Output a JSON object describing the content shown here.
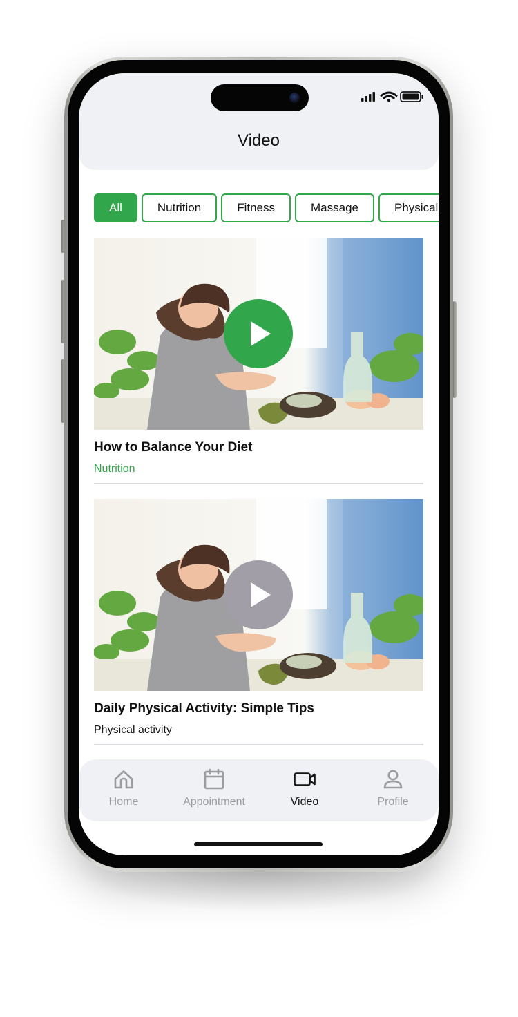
{
  "header": {
    "title": "Video"
  },
  "filters": [
    {
      "label": "All",
      "active": true
    },
    {
      "label": "Nutrition",
      "active": false
    },
    {
      "label": "Fitness",
      "active": false
    },
    {
      "label": "Massage",
      "active": false
    },
    {
      "label": "Physical",
      "active": false
    }
  ],
  "videos": [
    {
      "title": "How to Balance Your Diet",
      "category": "Nutrition",
      "category_color": "#31a64b",
      "play_color": "#31a64b"
    },
    {
      "title": "Daily Physical Activity: Simple Tips",
      "category": "Physical activity",
      "category_color": "#151515",
      "play_color": "#a29ea8"
    }
  ],
  "tabbar": {
    "items": [
      {
        "label": "Home",
        "icon": "home-icon",
        "active": false
      },
      {
        "label": "Appointment",
        "icon": "calendar-icon",
        "active": false
      },
      {
        "label": "Video",
        "icon": "video-camera-icon",
        "active": true
      },
      {
        "label": "Profile",
        "icon": "user-icon",
        "active": false
      }
    ]
  },
  "colors": {
    "accent": "#31a64b",
    "inactive_play": "#a29ea8",
    "header_bg": "#f0f1f5"
  }
}
